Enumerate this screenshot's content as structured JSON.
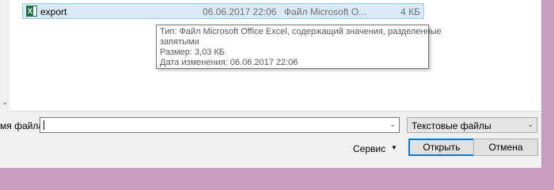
{
  "file_list": {
    "rows": [
      {
        "name": "export",
        "modified": "06.06.2017 22:06",
        "type": "Файл Microsoft O...",
        "size": "4 КБ",
        "icon": "excel-file-icon"
      }
    ]
  },
  "tooltip": {
    "line1": "Тип: Файл Microsoft Office Excel, содержащий значения, разделенные",
    "line2": "запятыми",
    "line3": "Размер: 3,03 КБ",
    "line4": "Дата изменения: 06.06.2017 22:06"
  },
  "footer": {
    "filename_label": "мя файла:",
    "filename_value": "",
    "filetype_selected": "Текстовые файлы",
    "service_label": "Сервис",
    "open_label": "Открыть",
    "cancel_label": "Отмена"
  },
  "colors": {
    "selection_bg": "#d9ebf9",
    "selection_border": "#99c9ef",
    "primary_border": "#0078d7",
    "excel_green": "#1f7246"
  }
}
